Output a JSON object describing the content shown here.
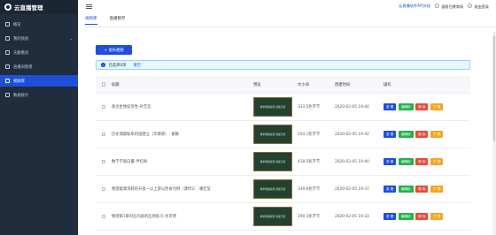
{
  "app": {
    "title": "云直播管理"
  },
  "sidebar": {
    "items": [
      {
        "label": "概览",
        "icon": "home-icon"
      },
      {
        "label": "我的频道",
        "icon": "channel-icon",
        "has_submenu": true
      },
      {
        "label": "先観看试",
        "icon": "play-icon"
      },
      {
        "label": "直播间管理",
        "icon": "monitor-icon"
      },
      {
        "label": "视频库",
        "icon": "video-icon",
        "active": true
      },
      {
        "label": "数据统计",
        "icon": "chart-icon"
      }
    ]
  },
  "header": {
    "api_link": "云直播软件API文档",
    "user": "道客巴教育网",
    "logout": "退出登录"
  },
  "tabs": [
    {
      "label": "视频库",
      "active": true
    },
    {
      "label": "直播暂存",
      "active": false
    }
  ],
  "toolbar": {
    "publish_label": "+ 发布视频"
  },
  "alert": {
    "icon": "i",
    "selected_text": "已选择0项",
    "clear_label": "清空"
  },
  "table": {
    "columns": [
      "标题",
      "预览",
      "大小/B",
      "创建时间",
      "操作"
    ],
    "rows": [
      {
        "title": "政治生物投资性-孙艺宏",
        "preview": "教学视频资源 黑板示意",
        "size": "333.5兆字节",
        "time": "2020-02-05 19:44"
      },
      {
        "title": "历史课题联系的国建立（华德驿）- 秦舞",
        "preview": "教学视频资源 黑板示意",
        "size": "254.1兆字节",
        "time": "2020-02-05 19:42"
      },
      {
        "title": "数学字面向量-尹红梅",
        "preview": "教学视频资源 黑板示意",
        "size": "418.5兆字节",
        "time": "2020-02-05 19:40"
      },
      {
        "title": "物理能源消耗的开发—以上游以西省为例（课时2）-潘佳莹",
        "preview": "教学视频资源 黑板示意",
        "size": "339.6兆字节",
        "time": "2020-02-05 19:37"
      },
      {
        "title": "物理第1章对应内容的应用练习-谷可明",
        "preview": "教学视频资源 黑板示意",
        "size": "290.1兆字节",
        "time": "2020-02-05 19:33"
      }
    ],
    "ops": {
      "view": "查 看",
      "edit": "编辑权",
      "del": "删 除",
      "dl": "下 载"
    }
  },
  "colors": {
    "primary": "#1e4fd9",
    "sidebar_bg": "#1f2d3d",
    "edit": "#22b34a",
    "del": "#e64b3c",
    "dl": "#f5a623"
  }
}
